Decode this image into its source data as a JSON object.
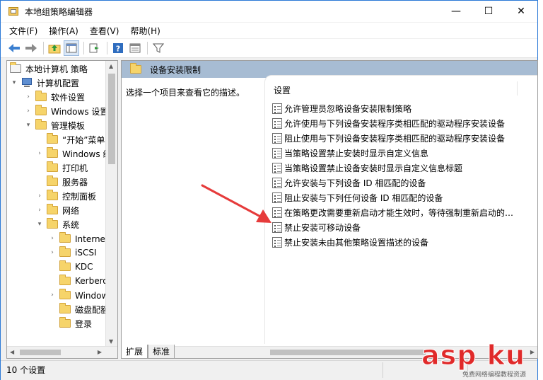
{
  "window": {
    "title": "本地组策略编辑器",
    "minimize": "—",
    "maximize": "☐",
    "close": "✕"
  },
  "menu": [
    "文件(F)",
    "操作(A)",
    "查看(V)",
    "帮助(H)"
  ],
  "tree": {
    "root": "本地计算机 策略",
    "items": [
      {
        "label": "计算机配置"
      },
      {
        "label": "软件设置"
      },
      {
        "label": "Windows 设置"
      },
      {
        "label": "管理模板"
      },
      {
        "label": "“开始”菜单和任务栏"
      },
      {
        "label": "Windows 组件"
      },
      {
        "label": "打印机"
      },
      {
        "label": "服务器"
      },
      {
        "label": "控制面板"
      },
      {
        "label": "网络"
      },
      {
        "label": "系统"
      },
      {
        "label": "Internet 通信管理"
      },
      {
        "label": "iSCSI"
      },
      {
        "label": "KDC"
      },
      {
        "label": "Kerberos"
      },
      {
        "label": "Windows 文件保护"
      },
      {
        "label": "磁盘配额"
      },
      {
        "label": "登录"
      }
    ]
  },
  "main": {
    "header_title": "设备安装限制",
    "description_prompt": "选择一个项目来查看它的描述。",
    "column_header": "设置",
    "policies": [
      "允许管理员忽略设备安装限制策略",
      "允许使用与下列设备安装程序类相匹配的驱动程序安装设备",
      "阻止使用与下列设备安装程序类相匹配的驱动程序安装设备",
      "当策略设置禁止安装时显示自定义信息",
      "当策略设置禁止设备安装时显示自定义信息标题",
      "允许安装与下列设备 ID 相匹配的设备",
      "阻止安装与下列任何设备 ID 相匹配的设备",
      "在策略更改需要重新启动才能生效时，等待强制重新启动的…",
      "禁止安装可移动设备",
      "禁止安装未由其他策略设置描述的设备"
    ]
  },
  "tabs": [
    "扩展",
    "标准"
  ],
  "status": {
    "count_text": "10 个设置"
  },
  "watermark": {
    "text": "asp ku",
    "sub": "免费网络编程教程资源"
  },
  "colors": {
    "header_bg": "#a7bcd3",
    "title_border": "#2b79d7",
    "annotation_arrow": "#e63b3b"
  }
}
